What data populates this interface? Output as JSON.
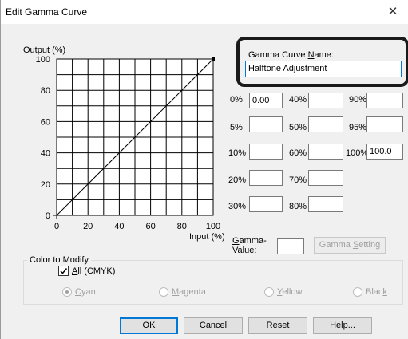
{
  "window": {
    "title": "Edit Gamma Curve",
    "close_glyph": "✕"
  },
  "graph": {
    "ylabel": "Output (%)",
    "xlabel": "Input (%)",
    "yticks": [
      "100",
      "80",
      "60",
      "40",
      "20",
      "0"
    ],
    "xticks": [
      "0",
      "20",
      "40",
      "60",
      "80",
      "100"
    ]
  },
  "chart_data": {
    "type": "line",
    "title": "",
    "xlabel": "Input (%)",
    "ylabel": "Output (%)",
    "xlim": [
      0,
      100
    ],
    "ylim": [
      0,
      100
    ],
    "grid": true,
    "x": [
      0,
      100
    ],
    "series": [
      {
        "values": [
          0,
          100
        ]
      }
    ]
  },
  "name_section": {
    "label": "Gamma Curve Name:",
    "value": "Halftone Adjustment"
  },
  "points": [
    {
      "label": "0%",
      "value": "0.00"
    },
    {
      "label": "5%",
      "value": ""
    },
    {
      "label": "10%",
      "value": ""
    },
    {
      "label": "20%",
      "value": ""
    },
    {
      "label": "30%",
      "value": ""
    },
    {
      "label": "40%",
      "value": ""
    },
    {
      "label": "50%",
      "value": ""
    },
    {
      "label": "60%",
      "value": ""
    },
    {
      "label": "70%",
      "value": ""
    },
    {
      "label": "80%",
      "value": ""
    },
    {
      "label": "90%",
      "value": ""
    },
    {
      "label": "95%",
      "value": ""
    },
    {
      "label": "100%",
      "value": "100.0"
    }
  ],
  "gamma": {
    "label1": "Gamma-",
    "label2": "Value:",
    "value": "",
    "setting_button": "Gamma Setting"
  },
  "color_modify": {
    "title": "Color to Modify",
    "all_label": "All (CMYK)",
    "all_checked": true,
    "radios": [
      "Cyan",
      "Magenta",
      "Yellow",
      "Black"
    ]
  },
  "buttons": {
    "ok": "OK",
    "cancel": "Cancel",
    "reset": "Reset",
    "help": "Help..."
  }
}
